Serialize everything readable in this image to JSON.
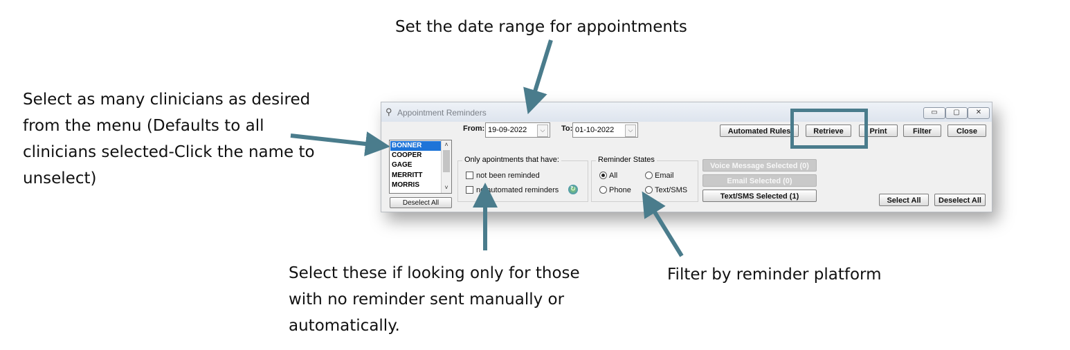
{
  "callouts": {
    "date": "Set the date range for appointments",
    "clinicians": "Select as many clinicians as desired from the menu (Defaults to all clinicians selected-Click the name to unselect)",
    "flags": "Select these if looking only for those with no reminder sent manually or automatically.",
    "platform": "Filter by reminder platform"
  },
  "window": {
    "title": "Appointment Reminders",
    "controls": {
      "minimize": "▭",
      "maximize": "▢",
      "close": "✕"
    }
  },
  "dates": {
    "from_label": "From:",
    "from_value": "19-09-2022",
    "to_label": "To:",
    "to_value": "01-10-2022"
  },
  "clinicians": {
    "items": [
      "BONNER",
      "COOPER",
      "GAGE",
      "MERRITT",
      "MORRIS"
    ],
    "selected": "BONNER",
    "deselect_all": "Deselect All"
  },
  "filters": {
    "group_label": "Only apointments that have:",
    "not_reminded": "not been reminded",
    "no_automated": "no automated reminders"
  },
  "reminder_states": {
    "group_label": "Reminder States",
    "all": "All",
    "email": "Email",
    "phone": "Phone",
    "text_sms": "Text/SMS",
    "selected": "All"
  },
  "actions": {
    "voice": "Voice Message Selected (0)",
    "email": "Email Selected (0)",
    "text_sms": "Text/SMS Selected (1)"
  },
  "toolbar": {
    "automated_rules": "Automated Rules",
    "retrieve": "Retrieve",
    "print": "Print",
    "filter": "Filter",
    "close": "Close",
    "select_all": "Select All",
    "deselect_all": "Deselect All"
  },
  "colors": {
    "arrow": "#4a7c8c",
    "selection": "#1e74d8"
  }
}
